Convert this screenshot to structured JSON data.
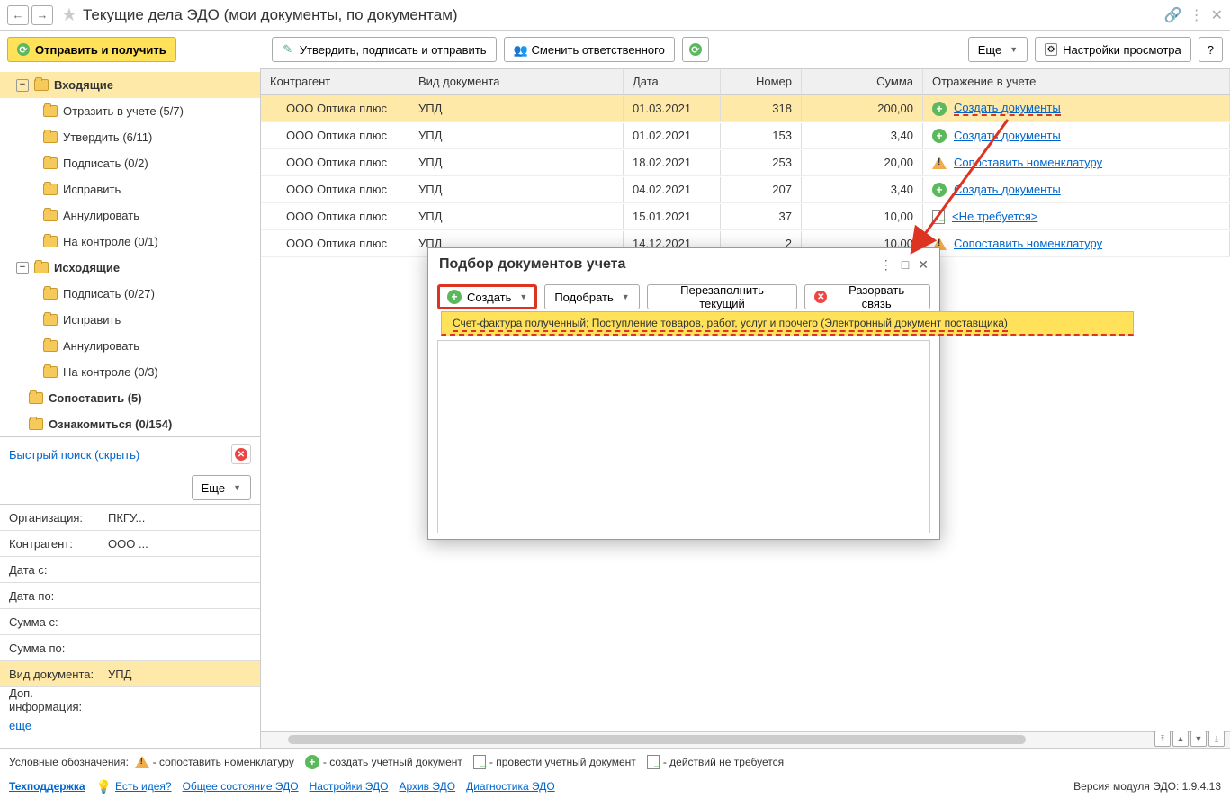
{
  "header": {
    "title": "Текущие дела ЭДО (мои документы, по документам)"
  },
  "toolbar": {
    "send_receive": "Отправить и получить",
    "approve": "Утвердить, подписать и отправить",
    "change_responsible": "Сменить ответственного",
    "more": "Еще",
    "view_settings": "Настройки просмотра",
    "help": "?"
  },
  "tree": {
    "incoming": "Входящие",
    "incoming_items": [
      "Отразить в учете (5/7)",
      "Утвердить (6/11)",
      "Подписать (0/2)",
      "Исправить",
      "Аннулировать",
      "На контроле (0/1)"
    ],
    "outgoing": "Исходящие",
    "outgoing_items": [
      "Подписать (0/27)",
      "Исправить",
      "Аннулировать",
      "На контроле (0/3)"
    ],
    "match": "Сопоставить (5)",
    "review": "Ознакомиться (0/154)"
  },
  "quick_search": "Быстрый поиск (скрыть)",
  "filter_more": "Еще",
  "filters": [
    {
      "label": "Организация:",
      "value": "ПКГУ..."
    },
    {
      "label": "Контрагент:",
      "value": "ООО ..."
    },
    {
      "label": "Дата с:",
      "value": ""
    },
    {
      "label": "Дата по:",
      "value": ""
    },
    {
      "label": "Сумма с:",
      "value": ""
    },
    {
      "label": "Сумма по:",
      "value": ""
    },
    {
      "label": "Вид документа:",
      "value": "УПД"
    },
    {
      "label": "Доп. информация:",
      "value": ""
    }
  ],
  "filter_more_link": "еще",
  "grid": {
    "columns": [
      "Контрагент",
      "Вид документа",
      "Дата",
      "Номер",
      "Сумма",
      "Отражение в учете"
    ],
    "rows": [
      {
        "c1": "ООО Оптика плюс",
        "c2": "УПД",
        "c3": "01.03.2021",
        "c4": "318",
        "c5": "200,00",
        "action": "Создать документы",
        "icon": "plus",
        "sel": true
      },
      {
        "c1": "ООО Оптика плюс",
        "c2": "УПД",
        "c3": "01.02.2021",
        "c4": "153",
        "c5": "3,40",
        "action": "Создать документы",
        "icon": "plus"
      },
      {
        "c1": "ООО Оптика плюс",
        "c2": "УПД",
        "c3": "18.02.2021",
        "c4": "253",
        "c5": "20,00",
        "action": "Сопоставить номенклатуру",
        "icon": "warn"
      },
      {
        "c1": "ООО Оптика плюс",
        "c2": "УПД",
        "c3": "04.02.2021",
        "c4": "207",
        "c5": "3,40",
        "action": "Создать документы",
        "icon": "plus"
      },
      {
        "c1": "ООО Оптика плюс",
        "c2": "УПД",
        "c3": "15.01.2021",
        "c4": "37",
        "c5": "10,00",
        "action": "<Не требуется>",
        "icon": "doc"
      },
      {
        "c1": "ООО Оптика плюс",
        "c2": "УПД",
        "c3": "14.12.2021",
        "c4": "2",
        "c5": "10,00",
        "action": "Сопоставить номенклатуру",
        "icon": "warn"
      }
    ]
  },
  "dialog": {
    "title": "Подбор документов учета",
    "create": "Создать",
    "pick": "Подобрать",
    "refill": "Перезаполнить текущий",
    "break": "Разорвать связь",
    "menu_item": "Счет-фактура полученный; Поступление товаров, работ, услуг и прочего (Электронный документ поставщика)"
  },
  "legend": {
    "label": "Условные обозначения:",
    "l1": "- сопоставить номенклатуру",
    "l2": "- создать учетный документ",
    "l3": "- провести учетный документ",
    "l4": "- действий не требуется"
  },
  "footer": {
    "version": "Версия модуля ЭДО: 1.9.4.13",
    "support": "Техподдержка",
    "idea": "Есть идея?",
    "links": [
      "Общее состояние ЭДО",
      "Настройки ЭДО",
      "Архив ЭДО",
      "Диагностика ЭДО"
    ]
  }
}
